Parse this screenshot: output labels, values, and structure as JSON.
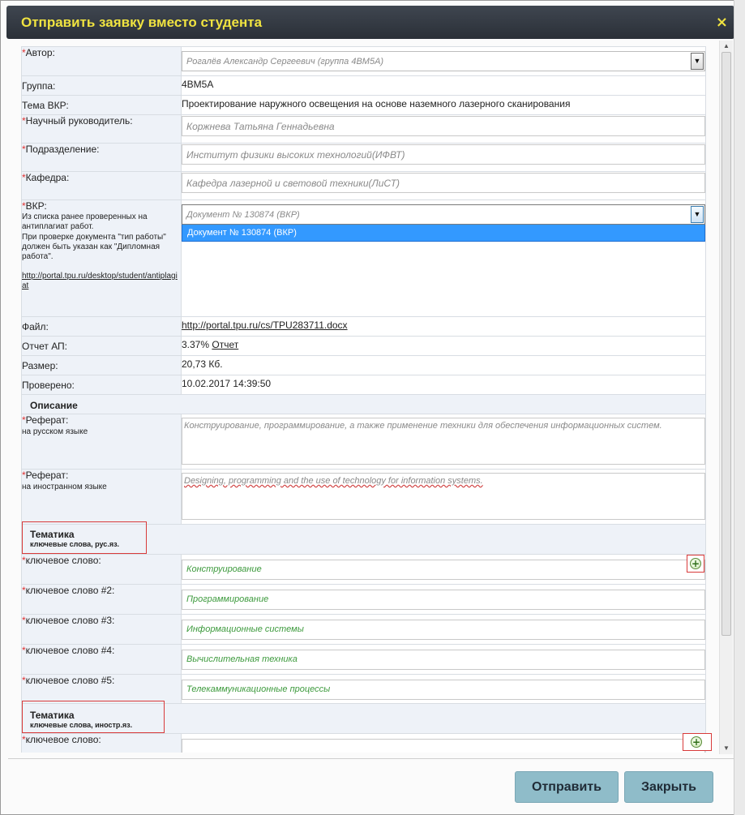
{
  "dialog": {
    "title": "Отправить заявку вместо студента",
    "close": "×"
  },
  "fields": {
    "author_label": "Автор:",
    "author_value": "Рогалёв Александр Сергеевич (группа 4ВМ5А)",
    "group_label": "Группа:",
    "group_value": "4ВМ5А",
    "topic_label": "Тема ВКР:",
    "topic_value": "Проектирование наружного освещения на основе наземного лазерного сканирования",
    "supervisor_label": "Научный руководитель:",
    "supervisor_value": "Коржнева Татьяна Геннадьевна",
    "division_label": "Подразделение:",
    "division_value": "Институт физики высоких технологий(ИФВТ)",
    "department_label": "Кафедра:",
    "department_value": "Кафедра лазерной и световой техники(ЛиСТ)",
    "vkr_label": "ВКР:",
    "vkr_hint1": "Из списка ранее проверенных на антиплагиат работ.",
    "vkr_hint2": "При проверке документа \"тип работы\" должен быть указан как \"Дипломная работа\".",
    "vkr_link": "http://portal.tpu.ru/desktop/student/antiplagiat",
    "vkr_select_value": "Документ № 130874 (ВКР)",
    "vkr_option": "Документ № 130874 (ВКР)",
    "file_label": "Файл:",
    "file_link": "http://portal.tpu.ru/cs/TPU283711.docx",
    "report_label": "Отчет АП:",
    "report_percent": "3.37%",
    "report_link": "Отчет",
    "size_label": "Размер:",
    "size_value": "20,73 Кб.",
    "checked_label": "Проверено:",
    "checked_value": "10.02.2017 14:39:50"
  },
  "description": {
    "title": "Описание",
    "abstract_ru_label": "Реферат:",
    "abstract_ru_sub": "на русском языке",
    "abstract_ru_value": "Конструирование, программирование, а также применение техники  для обеспечения информационных систем.",
    "abstract_en_label": "Реферат:",
    "abstract_en_sub": "на иностранном языке",
    "abstract_en_value": "Designing, programming and the use of technology for information systems."
  },
  "keywords_ru": {
    "title": "Тематика",
    "subtitle": "ключевые слова, рус.яз.",
    "items": [
      {
        "label": "ключевое слово:",
        "value": "Конструирование"
      },
      {
        "label": "ключевое слово #2:",
        "value": "Программирование"
      },
      {
        "label": "ключевое слово #3:",
        "value": "Информационные системы"
      },
      {
        "label": "ключевое слово #4:",
        "value": "Вычислительная техника"
      },
      {
        "label": "ключевое слово #5:",
        "value": "Телекаммуникационные процессы"
      }
    ]
  },
  "keywords_foreign": {
    "title": "Тематика",
    "subtitle": "ключевые слова, иностр.яз.",
    "items": [
      {
        "label": "ключевое слово:",
        "value": ""
      }
    ]
  },
  "buttons": {
    "submit": "Отправить",
    "close": "Закрыть"
  },
  "colors": {
    "title_text": "#f0e340",
    "title_bar": "#333a43",
    "required": "#e03030",
    "keyword_text": "#3d9a3d",
    "highlight_box": "#d83a3a",
    "button": "#8fbcc9",
    "dropdown_selected": "#3399ff"
  },
  "icons": {
    "add_keyword": "plus-circle-icon",
    "dropdown": "chevron-down-icon"
  }
}
